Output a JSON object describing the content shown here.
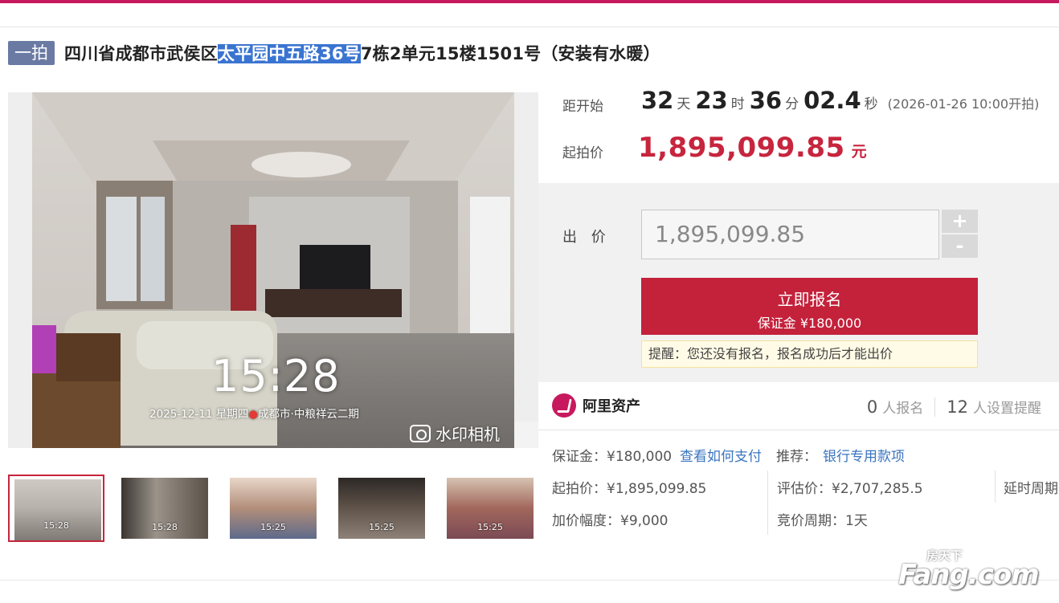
{
  "title": {
    "badge": "一拍",
    "prefix": "四川省成都市武侯区",
    "highlight": "太平园中五路36号",
    "suffix": "7栋2单元15楼1501号（安装有水暖）"
  },
  "photo": {
    "time": "15:28",
    "meta_date": "2025-12-11 星期四",
    "meta_location": "成都市·中粮祥云二期",
    "watermark": "水印相机",
    "zoom_icon": "magnifier-icon"
  },
  "thumbnails": [
    {
      "time": "15:28",
      "active": true
    },
    {
      "time": "15:28",
      "active": false
    },
    {
      "time": "15:25",
      "active": false
    },
    {
      "time": "15:25",
      "active": false
    },
    {
      "time": "15:25",
      "active": false
    }
  ],
  "countdown": {
    "label": "距开始",
    "days": "32",
    "days_unit": "天",
    "hours": "23",
    "hours_unit": "时",
    "minutes": "36",
    "minutes_unit": "分",
    "seconds": "02.4",
    "seconds_unit": "秒",
    "start_time": "(2026-01-26 10:00开拍)"
  },
  "start_price": {
    "label": "起拍价",
    "value": "1,895,099.85",
    "unit": "元"
  },
  "bid": {
    "label": "出 价",
    "input_value": "1,895,099.85",
    "plus": "+",
    "minus": "-",
    "signup_label": "立即报名",
    "deposit_label": "保证金 ¥180,000",
    "tip": "提醒：您还没有报名，报名成功后才能出价"
  },
  "platform": {
    "name": "阿里资产",
    "registered_count": "0",
    "registered_label": "人报名",
    "reminder_count": "12",
    "reminder_label": "人设置提醒"
  },
  "details": {
    "deposit": "保证金：¥180,000",
    "how_to_pay": "查看如何支付",
    "recommend_label": "推荐：",
    "recommend_link": "银行专用款项",
    "start_price": "起拍价：¥1,895,099.85",
    "appraisal": "评估价：¥2,707,285.5",
    "delay_period": "延时周期",
    "increment": "加价幅度：¥9,000",
    "bid_period": "竞价周期：1天"
  },
  "watermark_logo": {
    "text": "Fang.com",
    "cn": "房天下"
  },
  "colors": {
    "accent": "#c7195e",
    "price_red": "#c7253e",
    "button_red": "#c4213b",
    "badge_blue": "#6a7aa3",
    "highlight_blue": "#3a74d1",
    "link_blue": "#3a74c0"
  }
}
